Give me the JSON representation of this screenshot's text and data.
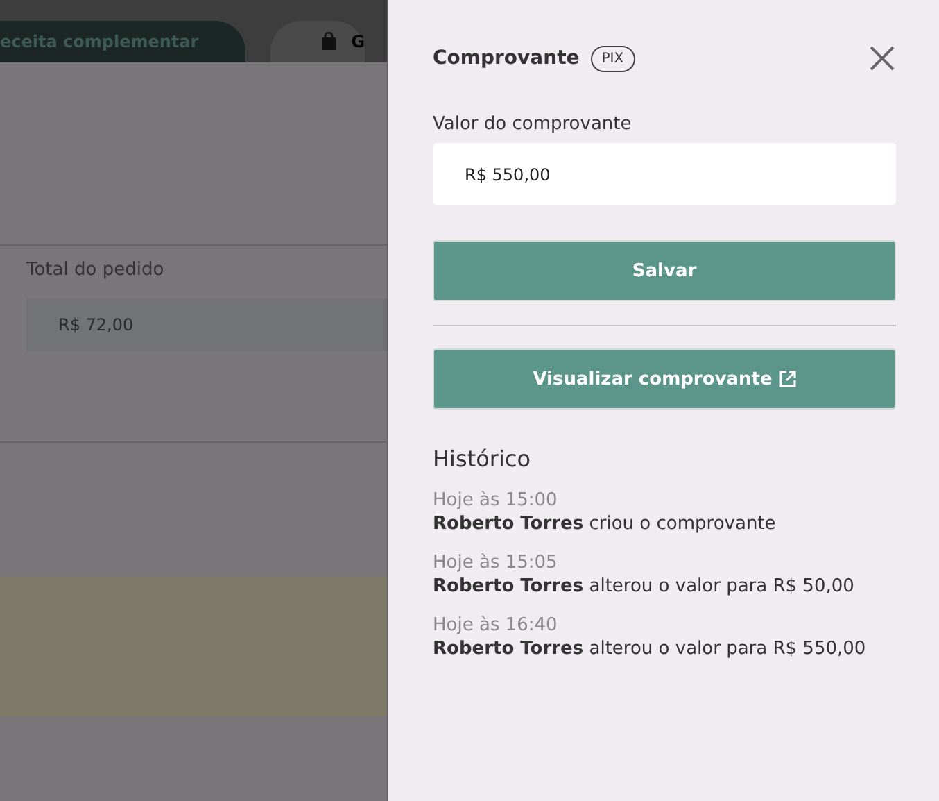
{
  "background": {
    "tabs": [
      {
        "label": "eceita complementar",
        "kind": "pill"
      },
      {
        "label": "G",
        "kind": "bag"
      }
    ],
    "total": {
      "label": "Total do pedido",
      "value": "R$ 72,00"
    }
  },
  "drawer": {
    "title": "Comprovante",
    "badge": "PIX",
    "field": {
      "label": "Valor do comprovante",
      "value": "R$ 550,00"
    },
    "save_button": "Salvar",
    "view_button": "Visualizar comprovante",
    "history": {
      "title": "Histórico",
      "entries": [
        {
          "time": "Hoje às 15:00",
          "text": "**Roberto Torres** criou o comprovante"
        },
        {
          "time": "Hoje às 15:05",
          "text": "**Roberto Torres** alterou o valor para R$ 50,00"
        },
        {
          "time": "Hoje às 16:40",
          "text": "**Roberto Torres** alterou o valor para R$ 550,00"
        }
      ]
    }
  }
}
